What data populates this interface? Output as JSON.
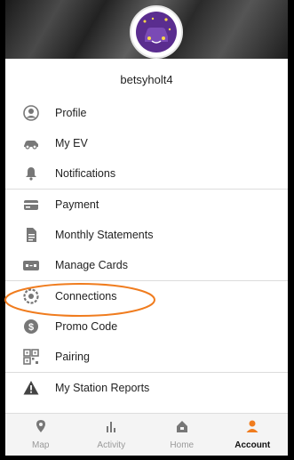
{
  "profile": {
    "username": "betsyholt4"
  },
  "menu_group1": [
    {
      "label": "Profile",
      "icon": "person-circle-icon"
    },
    {
      "label": "My EV",
      "icon": "car-icon"
    },
    {
      "label": "Notifications",
      "icon": "bell-icon"
    }
  ],
  "menu_group2": [
    {
      "label": "Payment",
      "icon": "credit-card-icon"
    },
    {
      "label": "Monthly Statements",
      "icon": "document-icon"
    },
    {
      "label": "Manage Cards",
      "icon": "cards-icon"
    }
  ],
  "menu_group3": [
    {
      "label": "Connections",
      "icon": "gear-link-icon"
    },
    {
      "label": "Promo Code",
      "icon": "dollar-badge-icon"
    },
    {
      "label": "Pairing",
      "icon": "qr-code-icon"
    }
  ],
  "menu_group4": [
    {
      "label": "My Station Reports",
      "icon": "warning-icon"
    }
  ],
  "bottom_nav": [
    {
      "label": "Map",
      "icon": "location-pin-icon",
      "active": false
    },
    {
      "label": "Activity",
      "icon": "bar-chart-icon",
      "active": false
    },
    {
      "label": "Home",
      "icon": "home-icon",
      "active": false
    },
    {
      "label": "Account",
      "icon": "person-icon",
      "active": true
    }
  ],
  "colors": {
    "accent": "#f07c1e",
    "avatar_bg": "#5a2d8f",
    "icon_gray": "#888888"
  }
}
